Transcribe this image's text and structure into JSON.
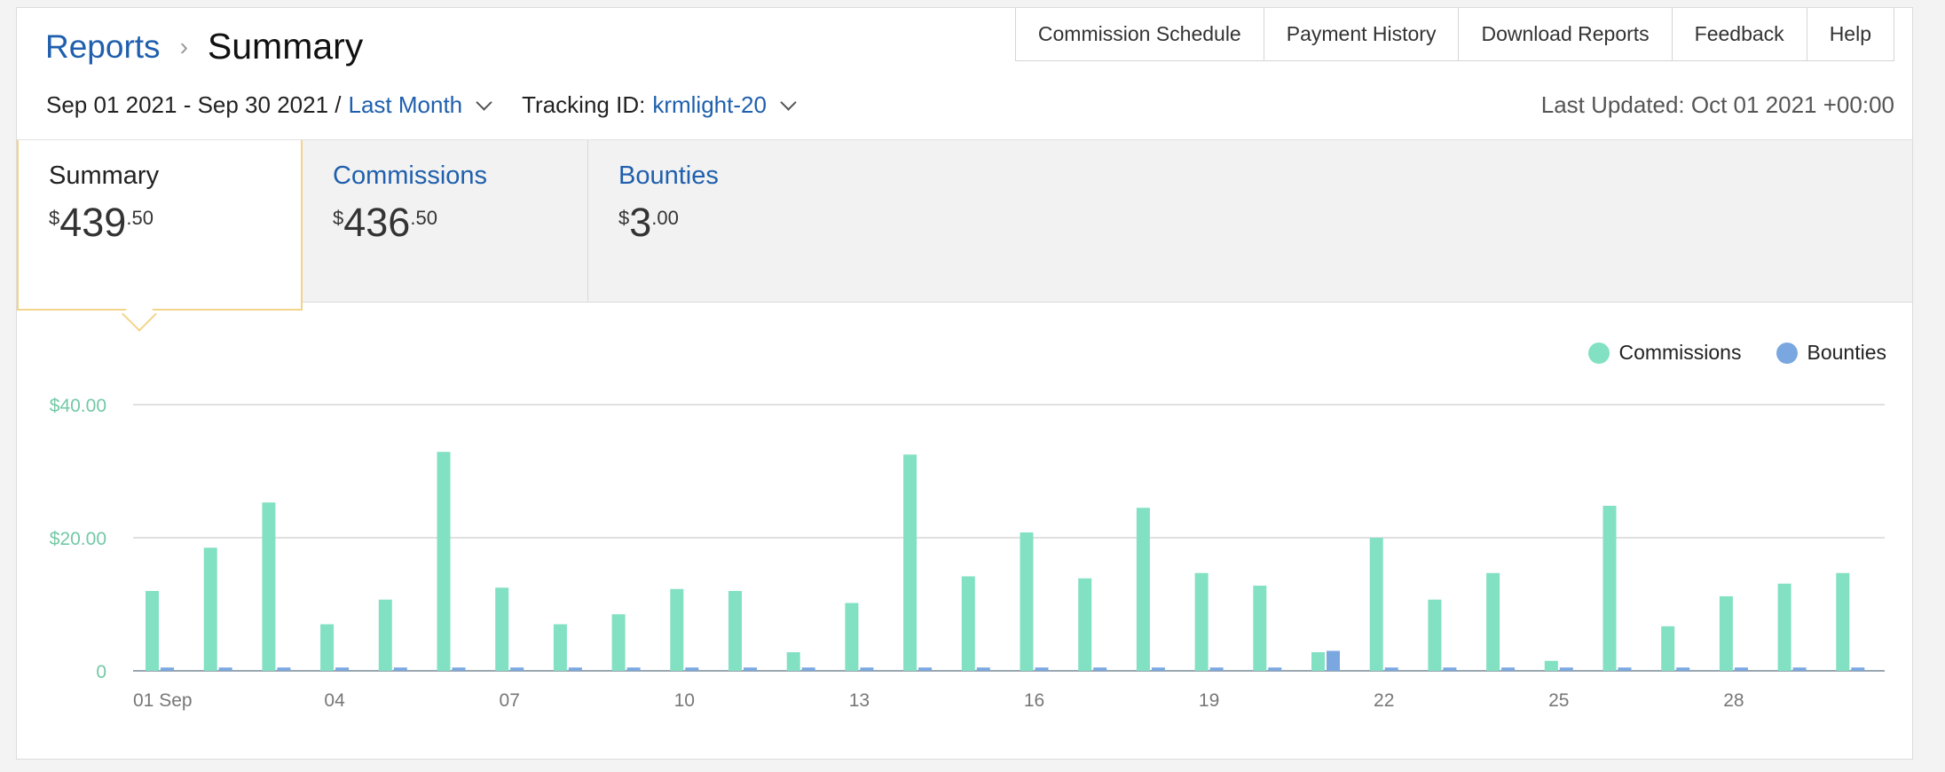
{
  "breadcrumb": {
    "parent": "Reports",
    "separator": "›",
    "current": "Summary"
  },
  "topnav": [
    "Commission Schedule",
    "Payment History",
    "Download Reports",
    "Feedback",
    "Help"
  ],
  "filters": {
    "date_range": "Sep 01 2021 - Sep 30 2021 /",
    "period": "Last Month",
    "tracking_label": "Tracking ID:",
    "tracking_id": "krmlight-20"
  },
  "last_updated": "Last Updated: Oct 01 2021 +00:00",
  "tabs": [
    {
      "label": "Summary",
      "currency": "$",
      "whole": "439",
      "cents": ".50",
      "active": true
    },
    {
      "label": "Commissions",
      "currency": "$",
      "whole": "436",
      "cents": ".50",
      "active": false
    },
    {
      "label": "Bounties",
      "currency": "$",
      "whole": "3",
      "cents": ".00",
      "active": false
    }
  ],
  "colors": {
    "commissions": "#82e0c3",
    "bounties": "#7ba7e0",
    "link": "#1f5fad",
    "tab_highlight": "#f2d48a"
  },
  "chart_data": {
    "type": "bar",
    "legend": [
      "Commissions",
      "Bounties"
    ],
    "legend_position": "top-right",
    "y_ticks": [
      "0",
      "$20.00",
      "$40.00"
    ],
    "ylim": [
      0,
      40
    ],
    "x_tick_labels": [
      "01 Sep",
      "04",
      "07",
      "10",
      "13",
      "16",
      "19",
      "22",
      "25",
      "28"
    ],
    "x_tick_days": [
      1,
      4,
      7,
      10,
      13,
      16,
      19,
      22,
      25,
      28
    ],
    "categories": [
      1,
      2,
      3,
      4,
      5,
      6,
      7,
      8,
      9,
      10,
      11,
      12,
      13,
      14,
      15,
      16,
      17,
      18,
      19,
      20,
      21,
      22,
      23,
      24,
      25,
      26,
      27,
      28,
      29,
      30
    ],
    "series": [
      {
        "name": "Commissions",
        "values": [
          12,
          18.5,
          25.3,
          7,
          10.7,
          32.9,
          12.5,
          7,
          8.5,
          12.3,
          12,
          2.8,
          10.2,
          32.5,
          14.2,
          20.8,
          13.9,
          24.5,
          14.7,
          12.8,
          2.8,
          20,
          10.7,
          14.7,
          1.5,
          24.8,
          6.7,
          11.2,
          13.1,
          14.7
        ]
      },
      {
        "name": "Bounties",
        "values": [
          0.5,
          0.5,
          0.5,
          0.5,
          0.5,
          0.5,
          0.5,
          0.5,
          0.5,
          0.5,
          0.5,
          0.5,
          0.5,
          0.5,
          0.5,
          0.5,
          0.5,
          0.5,
          0.5,
          0.5,
          3,
          0.5,
          0.5,
          0.5,
          0.5,
          0.5,
          0.5,
          0.5,
          0.5,
          0.5
        ]
      }
    ]
  }
}
